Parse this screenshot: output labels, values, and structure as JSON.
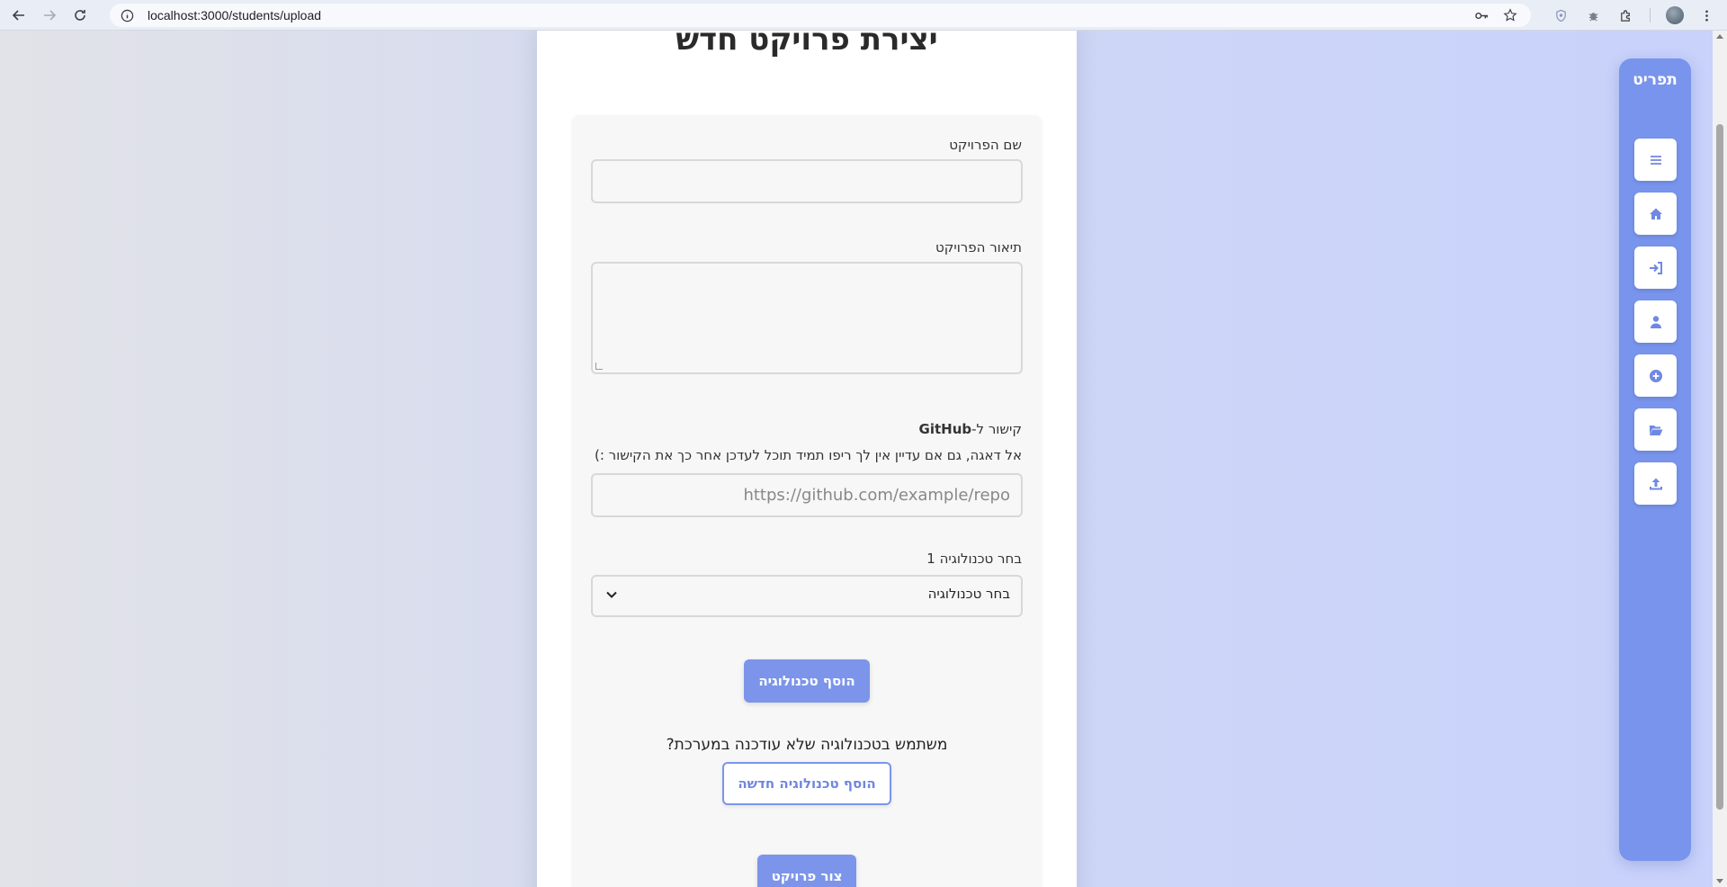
{
  "browser": {
    "url": "localhost:3000/students/upload"
  },
  "page": {
    "title": "יצירת פרויקט חדש"
  },
  "form": {
    "name_label": "שם הפרויקט",
    "name_value": "",
    "description_label": "תיאור הפרויקט",
    "description_value": "",
    "github_label_prefix": "קישור ל-",
    "github_label_bold": "GitHub",
    "github_note": "אל דאגה, גם אם עדיין אין לך ריפו תמיד תוכל לעדכן אחר כך את הקישור :)",
    "github_placeholder": "https://github.com/example/repo",
    "tech_label": "בחר טכנולוגיה 1",
    "tech_selected": "בחר טכנולוגיה",
    "add_tech_button": "הוסף טכנולוגיה",
    "missing_tech_question": "משתמש בטכנולוגיה שלא עודכנה במערכת?",
    "add_new_tech_button": "הוסף טכנולוגיה חדשה",
    "submit_button": "צור פרויקט"
  },
  "sidebar": {
    "brand": "תפריט",
    "items": [
      {
        "icon": "menu-icon"
      },
      {
        "icon": "home-icon"
      },
      {
        "icon": "sign-in-icon"
      },
      {
        "icon": "user-icon"
      },
      {
        "icon": "plus-circle-icon"
      },
      {
        "icon": "folder-open-icon"
      },
      {
        "icon": "upload-icon"
      }
    ]
  },
  "colors": {
    "accent": "#7c95ea",
    "sidebar": "#7894ec"
  }
}
